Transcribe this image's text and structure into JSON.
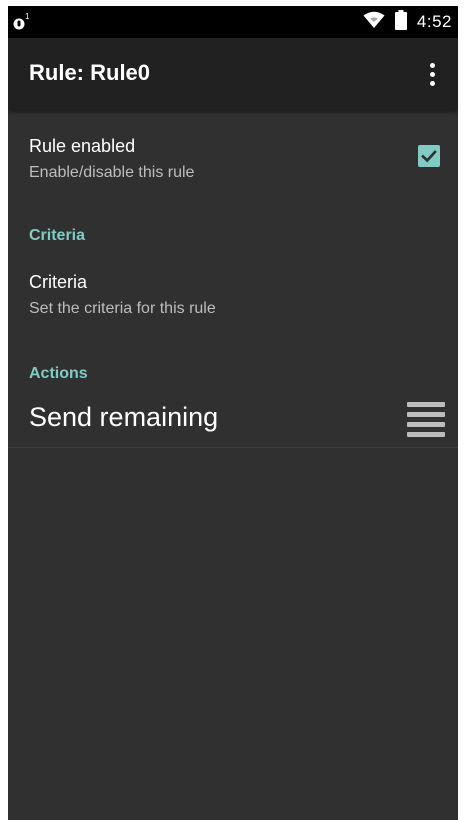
{
  "status_bar": {
    "time": "4:52",
    "icons": [
      "notification-icon",
      "wifi-icon",
      "battery-icon"
    ]
  },
  "app_bar": {
    "title": "Rule: Rule0",
    "overflow_icon": "more-vert-icon"
  },
  "prefs": {
    "rule_enabled": {
      "title": "Rule enabled",
      "summary": "Enable/disable this rule",
      "checked": true
    },
    "criteria_header": "Criteria",
    "criteria": {
      "title": "Criteria",
      "summary": "Set the criteria for this rule"
    },
    "actions_header": "Actions",
    "actions": [
      {
        "label": "Send remaining",
        "handle_icon": "drag-handle-icon"
      }
    ]
  },
  "colors": {
    "accent": "#80cbc4",
    "background": "#303030",
    "app_bar": "#212121",
    "status_bar": "#000000"
  }
}
